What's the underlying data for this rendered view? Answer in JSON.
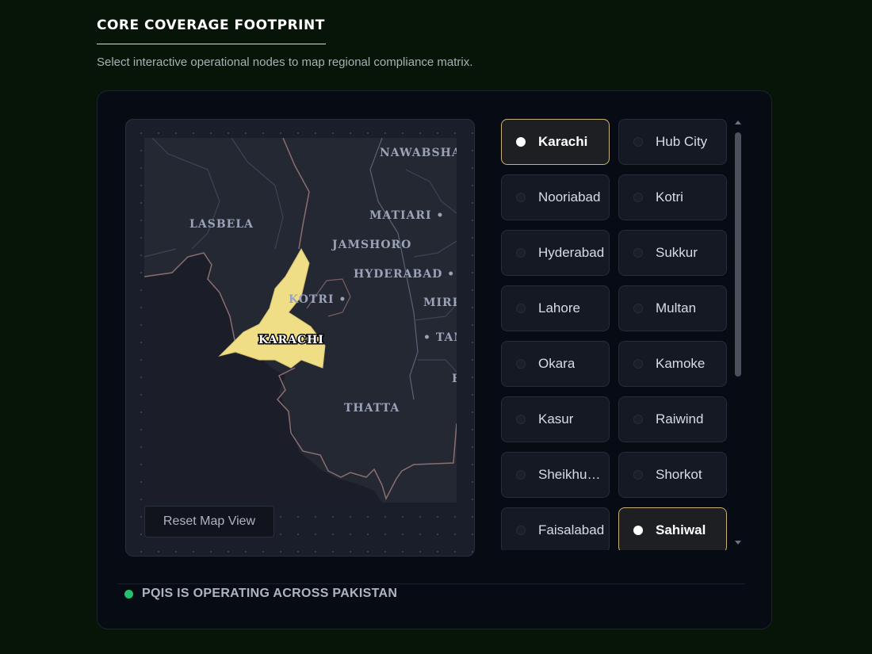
{
  "header": {
    "title": "CORE COVERAGE FOOTPRINT",
    "subtitle": "Select interactive operational nodes to map regional compliance matrix."
  },
  "map": {
    "region_labels": {
      "nawabshah": "NAWABSHAH",
      "lasbela": "LASBELA",
      "matiari": "MATIARI •",
      "jamshoro": "JAMSHORO",
      "hyderabad": "HYDERABAD •",
      "kotri": "KOTRI •",
      "mirpur": "MIRP",
      "karachi": "KARACHI",
      "tando": "• TAN",
      "badin": "B",
      "thatta": "THATTA"
    },
    "highlight_color": "#f0de86",
    "reset_label": "Reset Map View"
  },
  "nodes": [
    {
      "label": "Karachi",
      "active": true
    },
    {
      "label": "Hub City",
      "active": false
    },
    {
      "label": "Nooriabad",
      "active": false
    },
    {
      "label": "Kotri",
      "active": false
    },
    {
      "label": "Hyderabad",
      "active": false
    },
    {
      "label": "Sukkur",
      "active": false
    },
    {
      "label": "Lahore",
      "active": false
    },
    {
      "label": "Multan",
      "active": false
    },
    {
      "label": "Okara",
      "active": false
    },
    {
      "label": "Kamoke",
      "active": false
    },
    {
      "label": "Kasur",
      "active": false
    },
    {
      "label": "Raiwind",
      "active": false
    },
    {
      "label": "Sheikhupura",
      "active": false
    },
    {
      "label": "Shorkot",
      "active": false
    },
    {
      "label": "Faisalabad",
      "active": false
    },
    {
      "label": "Sahiwal",
      "active": true
    }
  ],
  "status": {
    "text": "PQIS IS OPERATING ACROSS PAKISTAN",
    "color": "#23c26b"
  },
  "colors": {
    "background": "#061508",
    "card": "#070b14",
    "accent_border": "#c9b277"
  }
}
